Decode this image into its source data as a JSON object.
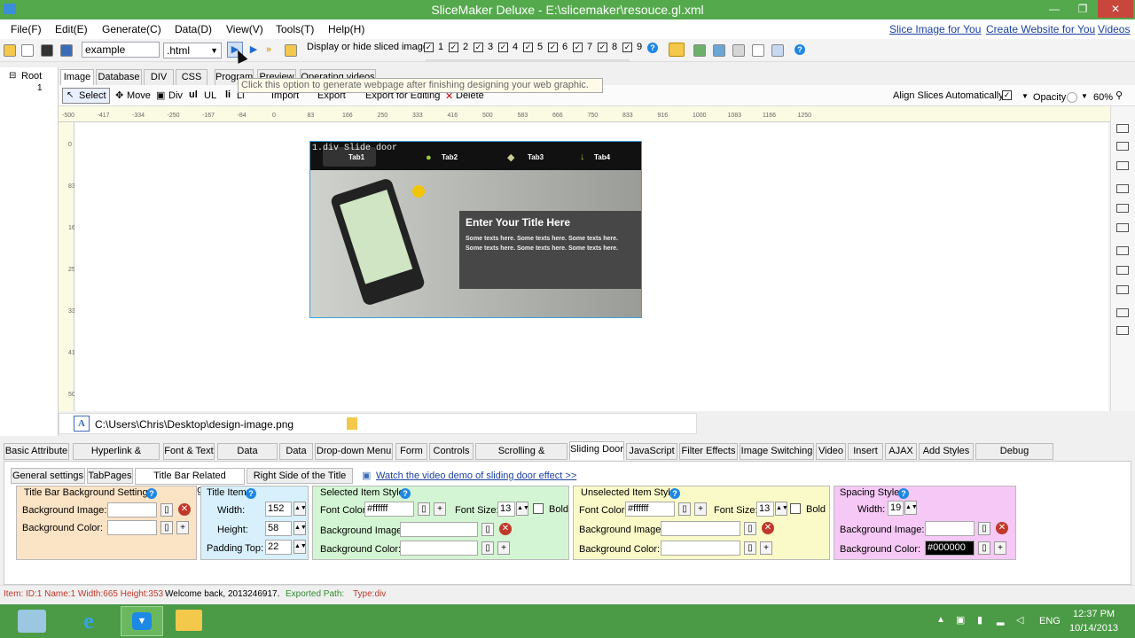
{
  "window": {
    "title": "SliceMaker Deluxe - E:\\slicemaker\\resouce.gl.xml",
    "minimize": "—",
    "restore": "❐",
    "close": "✕"
  },
  "menu": {
    "items": [
      "File(F)",
      "Edit(E)",
      "Generate(C)",
      "Data(D)",
      "View(V)",
      "Tools(T)",
      "Help(H)"
    ],
    "links": [
      "Slice Image for You",
      "Create Website for You",
      "Videos"
    ]
  },
  "toolbar": {
    "filename": "example",
    "ext": ".html",
    "display_label": "Display or hide sliced image:",
    "checks": [
      "1",
      "2",
      "3",
      "4",
      "5",
      "6",
      "7",
      "8",
      "9"
    ]
  },
  "tree": {
    "root": "Root",
    "child": "1"
  },
  "tabs": [
    "Image",
    "Database",
    "DIV",
    "CSS",
    "Program",
    "Preview",
    "Operating videos"
  ],
  "tooltip": "Click this option to generate webpage after finishing designing your web graphic.",
  "tools": {
    "select": "Select",
    "move": "Move",
    "div": "Div",
    "ul": "UL",
    "li": "Li",
    "import": "Import",
    "export": "Export",
    "export_edit": "Export for Editing",
    "delete": "Delete",
    "align": "Align Slices Automatically",
    "opacity": "Opacity",
    "opacity_val": "60%"
  },
  "ruler": {
    "h": [
      "-500",
      "-417",
      "-334",
      "-250",
      "-167",
      "-84",
      "0",
      "83",
      "166",
      "250",
      "333",
      "416",
      "500",
      "583",
      "666",
      "750",
      "833",
      "916",
      "1000",
      "1083",
      "1166",
      "1250"
    ],
    "v": [
      "0",
      "83",
      "166",
      "250",
      "333",
      "416",
      "500"
    ]
  },
  "canvas": {
    "label": "1.div Slide door",
    "tabs": [
      "Tab1",
      "Tab2",
      "Tab3",
      "Tab4"
    ],
    "heading": "Enter Your Title Here",
    "body1": "Some texts here. Some texts here. Some texts here.",
    "body2": "Some texts here. Some texts here. Some texts here."
  },
  "path": "C:\\Users\\Chris\\Desktop\\design-image.png",
  "bottom_tabs": [
    "Basic Attribute",
    "Hyperlink & Spacing",
    "Font & Text",
    "Data Sources",
    "Data",
    "Drop-down Menu",
    "Form",
    "Controls",
    "Scrolling & Movement",
    "Sliding Door",
    "JavaScript",
    "Filter Effects",
    "Image Switching",
    "Video",
    "Insert",
    "AJAX",
    "Add Styles",
    "Debug Information"
  ],
  "sub_tabs": [
    "General settings",
    "TabPages",
    "Title Bar Related Settings",
    "Right Side of the Title Bar"
  ],
  "video_link": "Watch the video demo of sliding door effect >>",
  "titlebar_bg": {
    "title": "Title Bar Background Settings",
    "bg_image": "Background Image:",
    "bg_color": "Background Color:"
  },
  "title_item": {
    "title": "Title Item",
    "width_lbl": "Width:",
    "width": "152",
    "height_lbl": "Height:",
    "height": "58",
    "padding_lbl": "Padding Top:",
    "padding": "22"
  },
  "selected": {
    "title": "Selected Item Style",
    "font_color_lbl": "Font Color:",
    "font_color": "#ffffff",
    "font_size_lbl": "Font Size:",
    "font_size": "13",
    "bold": "Bold",
    "bg_image": "Background Image:",
    "bg_color": "Background Color:"
  },
  "unselected": {
    "title": "Unselected Item Style",
    "font_color_lbl": "Font Color:",
    "font_color": "#ffffff",
    "font_size_lbl": "Font Size:",
    "font_size": "13",
    "bold": "Bold",
    "bg_image": "Background Image:",
    "bg_color": "Background Color:"
  },
  "spacing": {
    "title": "Spacing Style",
    "width_lbl": "Width:",
    "width": "19",
    "bg_image": "Background Image:",
    "bg_color": "Background Color:",
    "color": "#000000"
  },
  "status": {
    "item": "Item: ID:1 Name:1 Width:665 Height:353",
    "welcome": "Welcome back, 2013246917.",
    "exported": "Exported Path:",
    "type": "Type:div"
  },
  "taskbar": {
    "lang": "ENG",
    "time": "12:37 PM",
    "date": "10/14/2013"
  },
  "colors": {
    "accent": "#54a94c",
    "link": "#1a3fa0"
  }
}
